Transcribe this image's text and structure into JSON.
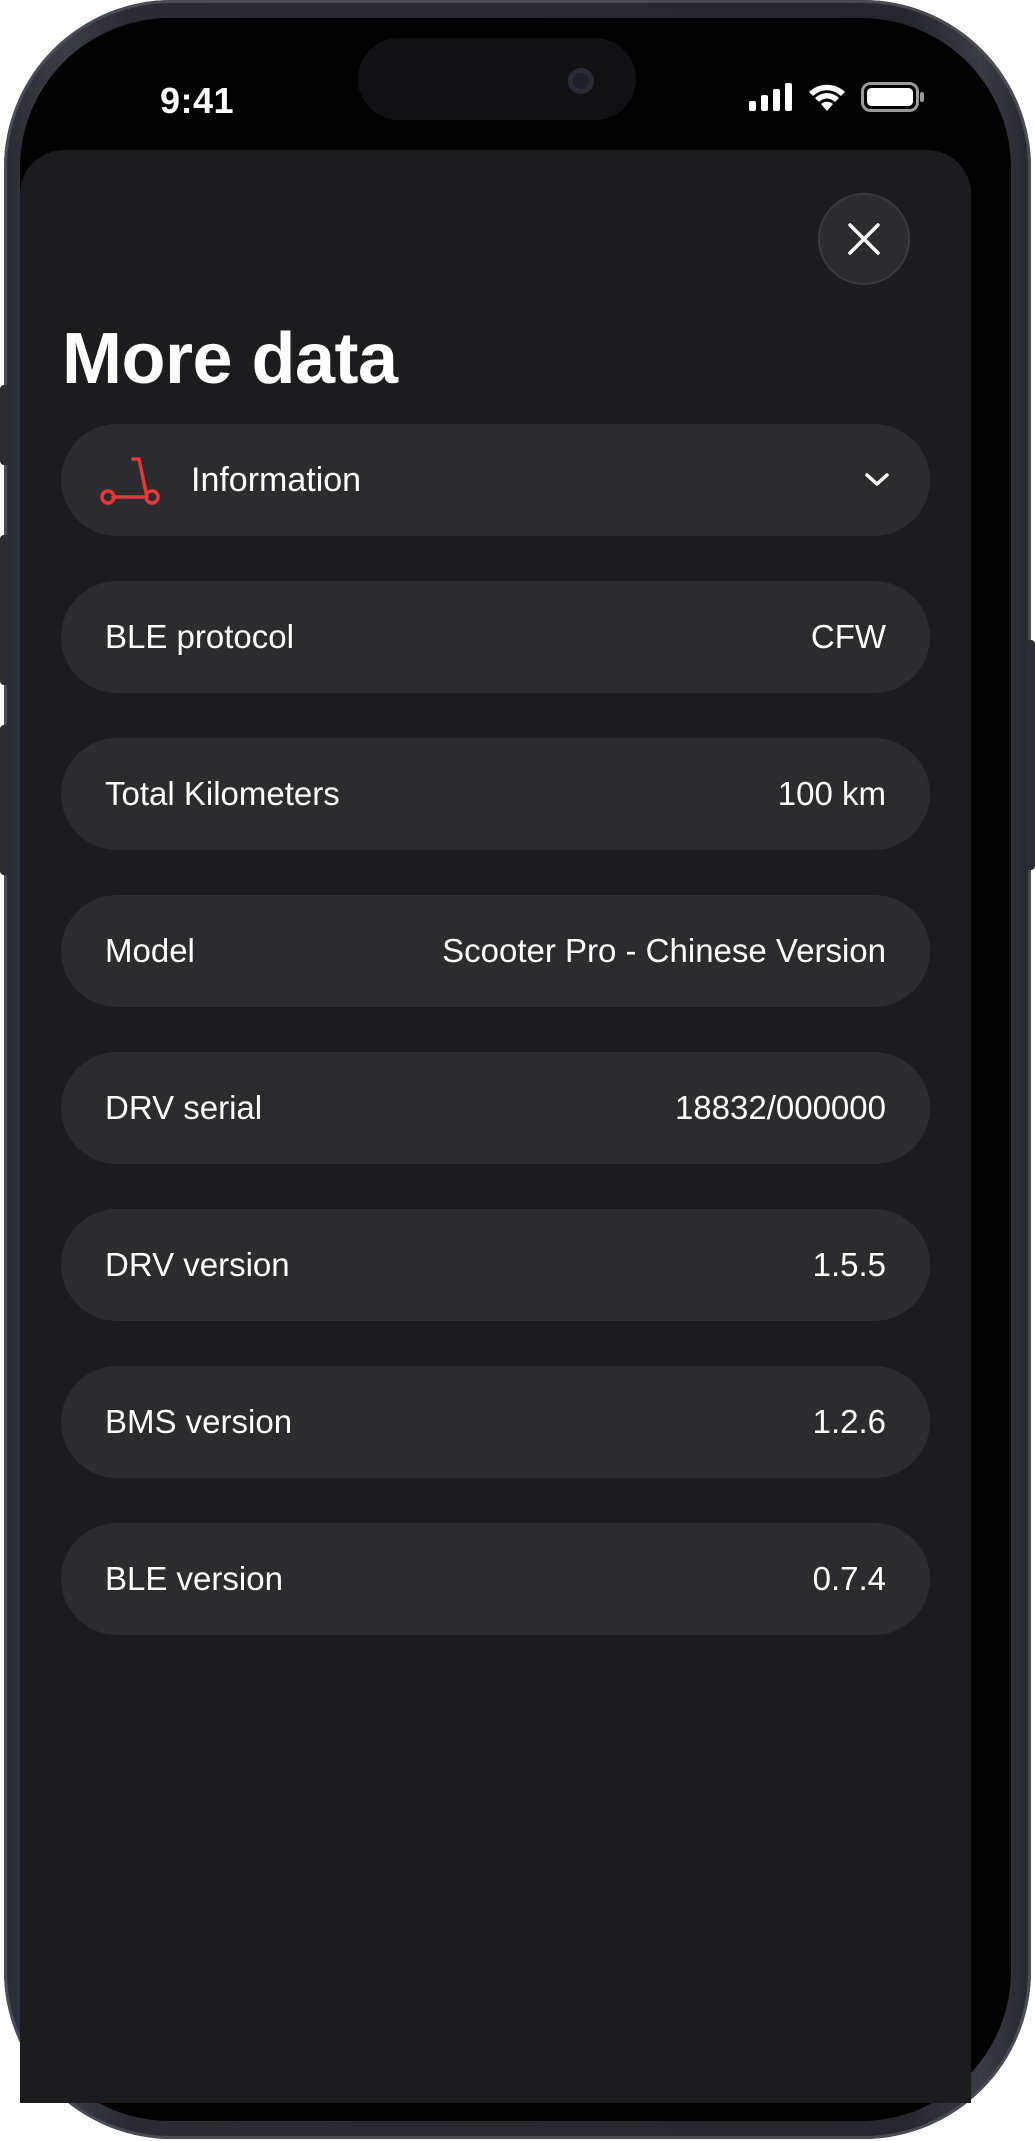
{
  "status_bar": {
    "time": "9:41"
  },
  "page": {
    "title": "More data"
  },
  "section": {
    "label": "Information",
    "icon": "scooter-icon",
    "accent_color": "#e5383b"
  },
  "rows": [
    {
      "label": "BLE protocol",
      "value": "CFW"
    },
    {
      "label": "Total Kilometers",
      "value": "100 km"
    },
    {
      "label": "Model",
      "value": "Scooter Pro - Chinese Version"
    },
    {
      "label": "DRV serial",
      "value": "18832/000000"
    },
    {
      "label": "DRV version",
      "value": "1.5.5"
    },
    {
      "label": "BMS version",
      "value": "1.2.6"
    },
    {
      "label": "BLE version",
      "value": "0.7.4"
    }
  ],
  "colors": {
    "sheet_background": "#1c1c1e",
    "row_background": "#2c2c2e",
    "text": "#ffffff"
  }
}
